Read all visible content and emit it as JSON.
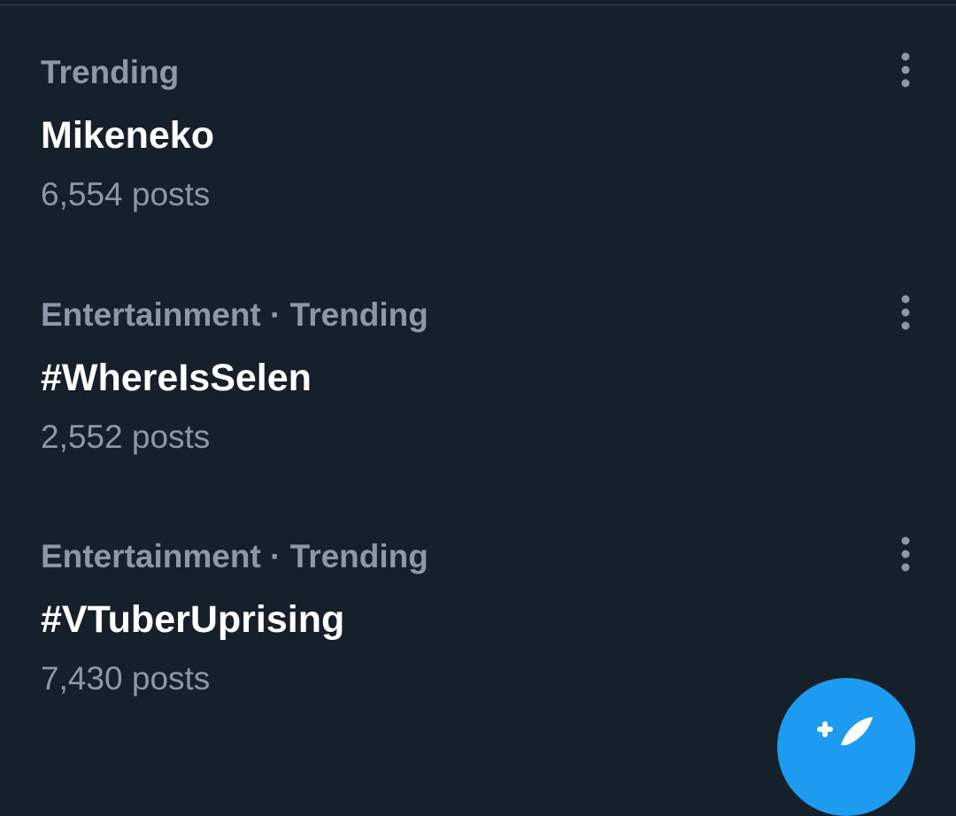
{
  "trends": [
    {
      "context": "Trending",
      "name": "Mikeneko",
      "count": "6,554 posts",
      "more_icon": "more-vertical-icon"
    },
    {
      "context": "Entertainment · Trending",
      "name": "#WhereIsSelen",
      "count": "2,552 posts",
      "more_icon": "more-vertical-icon"
    },
    {
      "context": "Entertainment · Trending",
      "name": "#VTuberUprising",
      "count": "7,430 posts",
      "more_icon": "more-vertical-icon"
    }
  ],
  "fab": {
    "icon": "compose-post-icon",
    "color": "#1d9bf0"
  },
  "colors": {
    "background": "#15202b",
    "primary_text": "#ffffff",
    "secondary_text": "#8b98a5",
    "divider": "#38444d"
  }
}
